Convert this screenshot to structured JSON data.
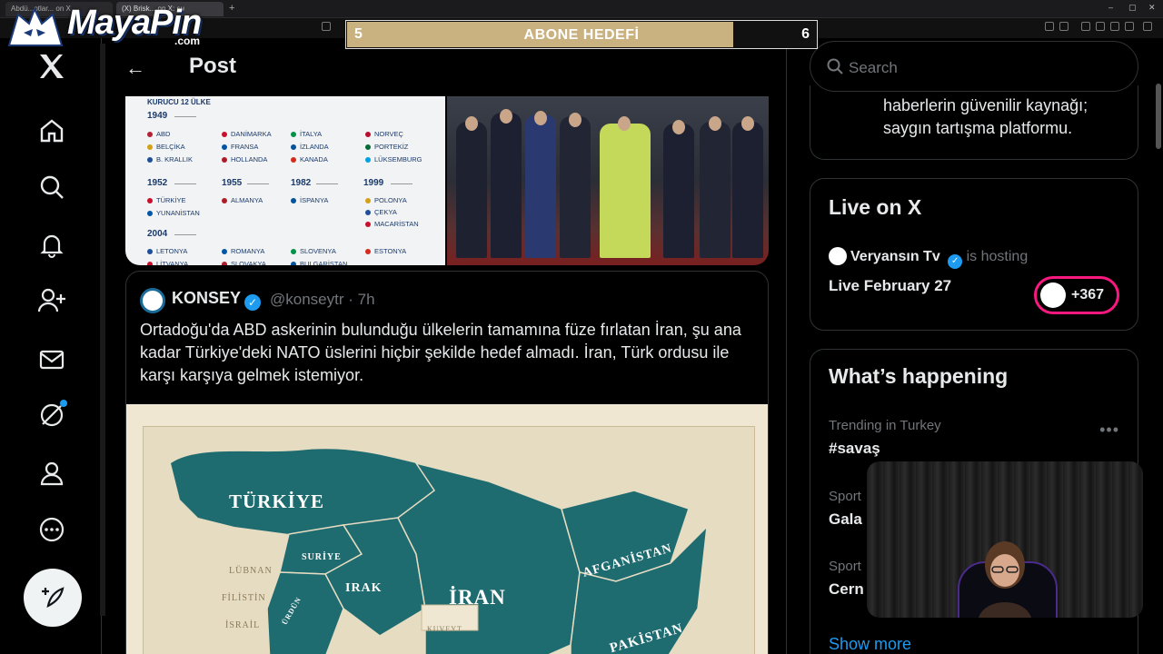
{
  "browser": {
    "tabs": [
      {
        "label": "Abdü...otlar... on X"
      },
      {
        "label": "(X) Brisk... on X: şu"
      }
    ],
    "new_tab": "+",
    "win_min": "–",
    "win_max": "▢",
    "win_close": "✕"
  },
  "overlay": {
    "logo_text": "MayaPin",
    "logo_com": ".com",
    "goal_title": "ABONE HEDEFİ",
    "goal_current": "5",
    "goal_target": "6",
    "goal_progress": 0.82
  },
  "nav": {
    "items": [
      "X",
      "Home",
      "Explore",
      "Notifications",
      "Follow",
      "Messages",
      "Grok",
      "Profile",
      "More"
    ]
  },
  "header": {
    "back": "←",
    "title": "Post"
  },
  "nato_infographic": {
    "heading": "KURUCU 12 ÜLKE",
    "years": {
      "y1949": "1949",
      "y1952": "1952",
      "y1955": "1955",
      "y1982": "1982",
      "y1999": "1999",
      "y2004": "2004"
    },
    "countries_1949": [
      "ABD",
      "BELÇİKA",
      "B. KRALLIK",
      "DANİMARKA",
      "FRANSA",
      "HOLLANDA",
      "İTALYA",
      "İZLANDA",
      "KANADA",
      "NORVEÇ",
      "PORTEKİZ",
      "LÜKSEMBURG"
    ],
    "countries_1952": [
      "TÜRKİYE",
      "YUNANİSTAN"
    ],
    "countries_1955": [
      "ALMANYA"
    ],
    "countries_1982": [
      "İSPANYA"
    ],
    "countries_1999": [
      "POLONYA",
      "ÇEKYA",
      "MACARİSTAN"
    ],
    "countries_2004": [
      "LETONYA",
      "LİTVANYA",
      "ROMANYA",
      "SLOVAKYA",
      "SLOVENYA",
      "BULGARİSTAN",
      "ESTONYA"
    ]
  },
  "quote": {
    "name": "KONSEY",
    "handle": "@konseytr · 7h",
    "text": "Ortadoğu'da ABD askerinin bulunduğu ülkelerin tamamına füze fırlatan İran, şu ana kadar Türkiye'deki NATO üslerini hiçbir şekilde hedef almadı. İran, Türk ordusu ile karşı karşıya gelmek istemiyor."
  },
  "map": {
    "labels": {
      "turkiye": "TÜRKİYE",
      "suriye": "SURİYE",
      "lubnan": "LÜBNAN",
      "filistin": "FİLİSTİN",
      "israil": "İSRAİL",
      "urdun": "ÜRDÜN",
      "irak": "IRAK",
      "iran": "İRAN",
      "kuveyt": "KUVEYT",
      "afganistan": "AFGANİSTAN",
      "pakistan": "PAKİSTAN"
    },
    "colors": {
      "land": "#1e6b70",
      "sea": "#e6dcc2"
    }
  },
  "right": {
    "search_placeholder": "Search",
    "card1_text_line1": "haberlerin güvenilir kaynağı;",
    "card1_text_line2": "saygın tartışma platformu.",
    "live_title": "Live on X",
    "live_host_name": "Veryansın Tv",
    "live_host_suffix": "is hosting",
    "live_date": "Live February 27",
    "live_count": "+367",
    "happening_title": "What’s happening",
    "trends": [
      {
        "meta": "Trending in Turkey",
        "name": "#savaş"
      },
      {
        "meta": "Sport",
        "name": "Gala"
      },
      {
        "meta": "Sport",
        "name": "Cern"
      }
    ],
    "more": "•••",
    "show_more": "Show more"
  },
  "colors": {
    "accent": "#1d9bf0",
    "live_ring": "#f91880",
    "goal_fill": "#c9b180"
  }
}
